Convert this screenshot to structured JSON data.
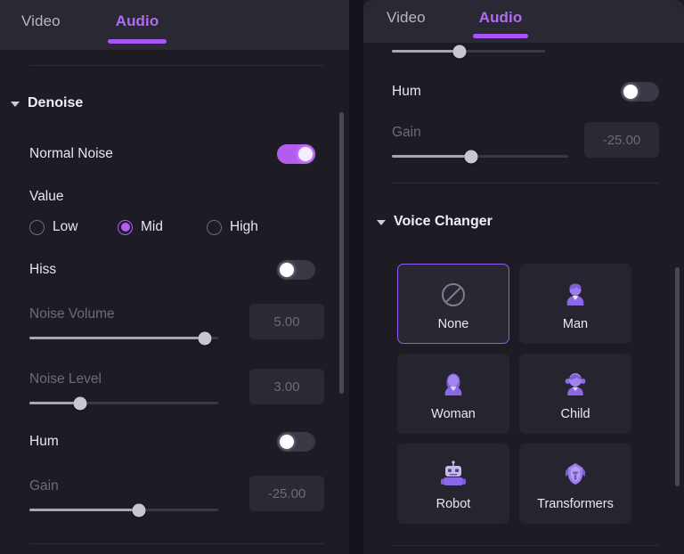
{
  "app": {
    "accent": "#a855f7",
    "panel_bg": "#1d1c24",
    "header_bg": "#2a2832",
    "canvas_bg": "#131219"
  },
  "left_panel": {
    "tabs": [
      {
        "label": "Video",
        "active": false
      },
      {
        "label": "Audio",
        "active": true
      }
    ],
    "sections": [
      {
        "title": "Denoise",
        "rows": [
          {
            "type": "toggle",
            "label": "Normal Noise",
            "state": "on"
          },
          {
            "type": "radio_group",
            "label": "Value",
            "options": [
              {
                "label": "Low",
                "selected": false
              },
              {
                "label": "Mid",
                "selected": true
              },
              {
                "label": "High",
                "selected": false
              }
            ]
          },
          {
            "type": "toggle",
            "label": "Hiss",
            "state": "off"
          },
          {
            "type": "slider",
            "label": "Noise Volume",
            "value": "5.00",
            "percent": 93,
            "disabled": true
          },
          {
            "type": "slider",
            "label": "Noise Level",
            "value": "3.00",
            "percent": 27,
            "disabled": true
          },
          {
            "type": "toggle",
            "label": "Hum",
            "state": "off"
          },
          {
            "type": "slider",
            "label": "Gain",
            "value": "-25.00",
            "percent": 58,
            "disabled": true
          }
        ]
      }
    ]
  },
  "right_panel": {
    "tabs": [
      {
        "label": "Video",
        "active": false
      },
      {
        "label": "Audio",
        "active": true
      }
    ],
    "partial_top": {
      "slider_percent": 44,
      "value_box_clipped": true
    },
    "rows": [
      {
        "type": "toggle",
        "label": "Hum",
        "state": "off"
      },
      {
        "type": "slider",
        "label": "Gain",
        "value": "-25.00",
        "percent": 45,
        "disabled": true
      }
    ],
    "voice_changer": {
      "title": "Voice Changer",
      "cards": [
        {
          "label": "None",
          "icon": "no-entry-icon",
          "selected": true
        },
        {
          "label": "Man",
          "icon": "man-icon",
          "selected": false
        },
        {
          "label": "Woman",
          "icon": "woman-icon",
          "selected": false
        },
        {
          "label": "Child",
          "icon": "child-icon",
          "selected": false
        },
        {
          "label": "Robot",
          "icon": "robot-icon",
          "selected": false
        },
        {
          "label": "Transformers",
          "icon": "transformers-icon",
          "selected": false
        }
      ]
    }
  }
}
